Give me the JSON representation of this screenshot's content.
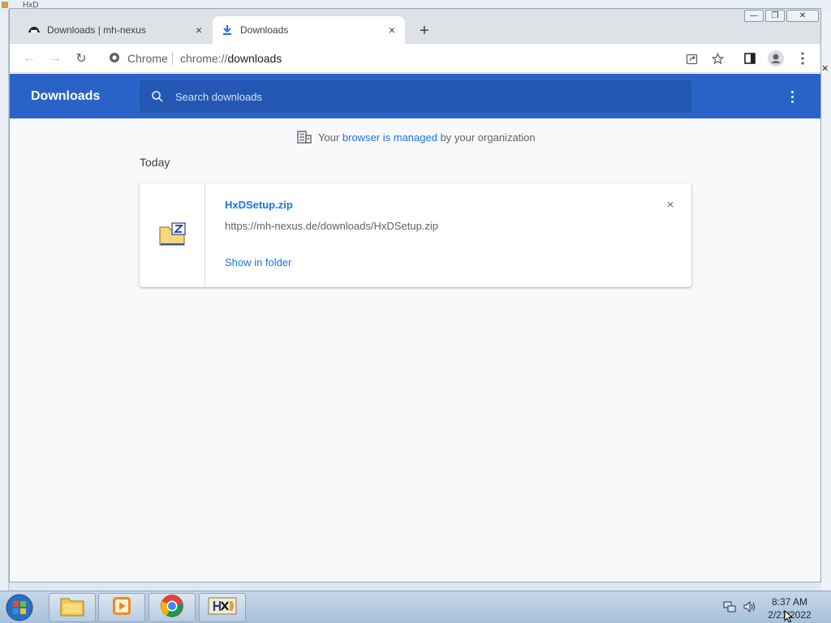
{
  "background": {
    "window_title": "HxD"
  },
  "tabs": [
    {
      "title": "Downloads | mh-nexus",
      "close": "×"
    },
    {
      "title": "Downloads",
      "close": "×"
    }
  ],
  "newtab_label": "+",
  "window_controls": {
    "minimize": "—",
    "restore": "❐",
    "close": "✕"
  },
  "toolbar": {
    "back": "←",
    "forward": "→",
    "reload": "↻",
    "chip_label": "Chrome",
    "url_scheme": "chrome://",
    "url_path": "downloads"
  },
  "downloads": {
    "title": "Downloads",
    "search_placeholder": "Search downloads",
    "managed": {
      "prefix": "Your ",
      "link": "browser is managed",
      "suffix": " by your organization"
    },
    "section": "Today",
    "items": [
      {
        "file_name": "HxDSetup.zip",
        "url": "https://mh-nexus.de/downloads/HxDSetup.zip",
        "action": "Show in folder",
        "remove": "×"
      }
    ]
  },
  "taskbar": {
    "time": "8:37 AM",
    "date": "2/21/2022"
  },
  "colors": {
    "accent": "#1a73e8",
    "header": "#2a63c8"
  }
}
